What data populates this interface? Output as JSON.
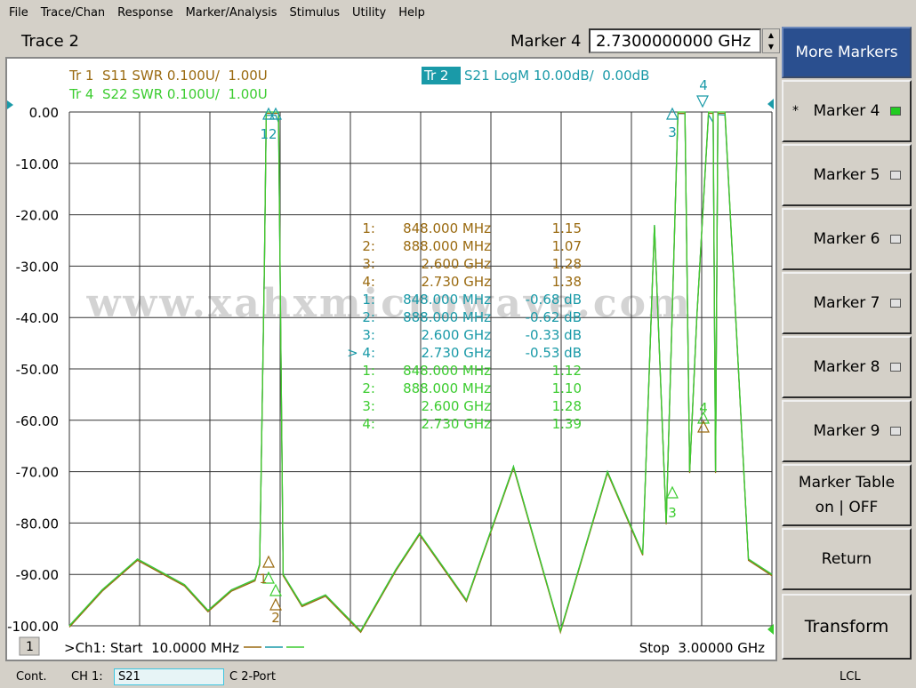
{
  "menu": [
    "File",
    "Trace/Chan",
    "Response",
    "Marker/Analysis",
    "Stimulus",
    "Utility",
    "Help"
  ],
  "header": {
    "trace_title": "Trace 2",
    "marker_label": "Marker 4",
    "marker_value": "2.7300000000 GHz"
  },
  "traces": {
    "tr1": "Tr 1  S11 SWR 0.100U/  1.00U",
    "tr4": "Tr 4  S22 SWR 0.100U/  1.00U",
    "tr2_tag": "Tr 2",
    "tr2": "S21 LogM 10.00dB/  0.00dB"
  },
  "colors": {
    "s11": "#9a6a10",
    "s21": "#1a9aa8",
    "s22": "#3ccc30",
    "grid": "#333333",
    "panel_active": "#2a4f8f"
  },
  "y_ticks": [
    "0.00",
    "-10.00",
    "-20.00",
    "-30.00",
    "-40.00",
    "-50.00",
    "-60.00",
    "-70.00",
    "-80.00",
    "-90.00",
    "-100.00"
  ],
  "marker_table": [
    {
      "id": "1:",
      "freq": "848.000 MHz",
      "val": "1.15",
      "trace": "s11"
    },
    {
      "id": "2:",
      "freq": "888.000 MHz",
      "val": "1.07",
      "trace": "s11"
    },
    {
      "id": "3:",
      "freq": "2.600 GHz",
      "val": "1.28",
      "trace": "s11"
    },
    {
      "id": "4:",
      "freq": "2.730 GHz",
      "val": "1.38",
      "trace": "s11"
    },
    {
      "id": "1:",
      "freq": "848.000 MHz",
      "val": "-0.68 dB",
      "trace": "s21"
    },
    {
      "id": "2:",
      "freq": "888.000 MHz",
      "val": "-0.62 dB",
      "trace": "s21"
    },
    {
      "id": "3:",
      "freq": "2.600 GHz",
      "val": "-0.33 dB",
      "trace": "s21"
    },
    {
      "id": "> 4:",
      "freq": "2.730 GHz",
      "val": "-0.53 dB",
      "trace": "s21"
    },
    {
      "id": "1:",
      "freq": "848.000 MHz",
      "val": "1.12",
      "trace": "s22"
    },
    {
      "id": "2:",
      "freq": "888.000 MHz",
      "val": "1.10",
      "trace": "s22"
    },
    {
      "id": "3:",
      "freq": "2.600 GHz",
      "val": "1.28",
      "trace": "s22"
    },
    {
      "id": "4:",
      "freq": "2.730 GHz",
      "val": "1.39",
      "trace": "s22"
    }
  ],
  "watermark": "www.xahxmicrowave.com",
  "markers_on_plot": {
    "m12": "12",
    "m3": "3",
    "m4": "4",
    "m3b": "3",
    "m4b": "4",
    "m1b": "1",
    "m2b": "2"
  },
  "footer": {
    "channel_badge": "1",
    "start": ">Ch1: Start  10.0000 MHz",
    "stop": "Stop  3.00000 GHz"
  },
  "softkeys": {
    "more_markers": "More Markers",
    "marker4": "Marker 4",
    "marker5": "Marker 5",
    "marker6": "Marker 6",
    "marker7": "Marker 7",
    "marker8": "Marker 8",
    "marker9": "Marker 9",
    "marker_table_l1": "Marker Table",
    "marker_table_l2": "on | OFF",
    "return": "Return",
    "transform": "Transform",
    "star": "*"
  },
  "status": {
    "cont": "Cont.",
    "ch": "CH 1:",
    "sparam": "S21",
    "port": "C  2-Port",
    "lcl": "LCL"
  },
  "chart_data": {
    "type": "line",
    "x_unit": "GHz",
    "xlim": [
      0.01,
      3.0
    ],
    "ylim": [
      -100,
      0
    ],
    "y_unit": "dB",
    "grid": true,
    "markers": {
      "x": [
        0.848,
        0.888,
        2.6,
        2.73
      ]
    },
    "series": [
      {
        "name": "S21 LogM",
        "x": [
          0.01,
          0.15,
          0.3,
          0.5,
          0.6,
          0.7,
          0.8,
          0.82,
          0.84,
          0.848,
          0.888,
          0.9,
          0.92,
          1.0,
          1.1,
          1.25,
          1.4,
          1.5,
          1.7,
          1.9,
          2.1,
          2.3,
          2.45,
          2.5,
          2.55,
          2.6,
          2.63,
          2.65,
          2.68,
          2.73,
          2.75,
          2.76,
          2.77,
          2.8,
          2.9,
          3.0
        ],
        "y": [
          -100,
          -93,
          -87,
          -92,
          -97,
          -93,
          -91,
          -88,
          -30,
          -0.68,
          -0.62,
          -2,
          -90,
          -96,
          -94,
          -101,
          -89,
          -82,
          -95,
          -69,
          -101,
          -70,
          -86,
          -22,
          -80,
          -0.33,
          -0.3,
          -70,
          -40,
          -0.53,
          -2,
          -70,
          -0.5,
          -0.6,
          -87,
          -90
        ]
      }
    ]
  }
}
